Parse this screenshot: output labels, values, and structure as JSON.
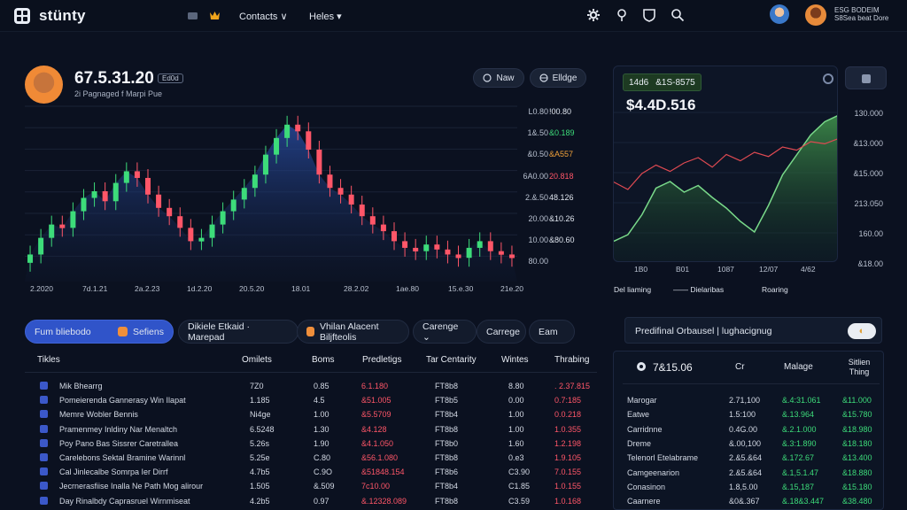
{
  "nav": {
    "brand": "stünty",
    "links": [
      "Contacts ∨",
      "Heles ▾"
    ]
  },
  "user": {
    "line1": "ESG BODEIM",
    "line2": "S8Sea beat Dore"
  },
  "header": {
    "price": "67.5.31.20",
    "chip": "Ed0d",
    "subtitle": "2i Pagnaged f Marpi Pue",
    "buttons": [
      "Naw",
      "Elldge"
    ]
  },
  "main_chart": {
    "y_labels": [
      "L0.80",
      "1&.50",
      "&0.50",
      "6A0.00",
      "2.&.50",
      "20.00",
      "10.00",
      "80.00"
    ],
    "badges": [
      "!00.80",
      "&0.189",
      "&A557",
      "20.818",
      "48.126",
      "&10.26",
      "&80.60"
    ],
    "x_labels": [
      "2.2020",
      "7d.1.21",
      "2a.2.23",
      "1d.2.20",
      "20.5.20",
      "18.01",
      "28.2.02",
      "1ae.80",
      "15.e.30",
      "21e.20"
    ]
  },
  "chart_data": {
    "type": "candlestick",
    "title": "",
    "y_tick_labels": [
      "L0.80",
      "1&.50",
      "&0.50",
      "6A0.00",
      "2.&.50",
      "20.00",
      "10.00",
      "80.00"
    ],
    "x_tick_labels": [
      "2.2020",
      "7d.1.21",
      "2a.2.23",
      "1d.2.20",
      "20.5.20",
      "18.01",
      "28.2.02",
      "1ae.80",
      "15.e.30",
      "21e.20"
    ],
    "close_levels": [
      0.12,
      0.22,
      0.3,
      0.28,
      0.38,
      0.46,
      0.5,
      0.44,
      0.55,
      0.62,
      0.58,
      0.48,
      0.4,
      0.35,
      0.28,
      0.2,
      0.22,
      0.3,
      0.38,
      0.45,
      0.52,
      0.6,
      0.72,
      0.82,
      0.9,
      0.86,
      0.75,
      0.6,
      0.52,
      0.48,
      0.42,
      0.35,
      0.3,
      0.26,
      0.2,
      0.16,
      0.14,
      0.18,
      0.15,
      0.12,
      0.1,
      0.16,
      0.2,
      0.14,
      0.12,
      0.1
    ]
  },
  "side_chart": {
    "badge": "14d6",
    "badge_value": "&1S-8575",
    "value": "$4.4D.516",
    "y_labels": [
      "130.000",
      "&13.000",
      "&15.000",
      "213.050",
      "160.00",
      "&18.00"
    ],
    "x_labels": [
      "1B0",
      "B01",
      "1087",
      "12/07",
      "4/62"
    ],
    "legend": [
      "Del liaming",
      "—— Dielaribas",
      "Roaring"
    ]
  },
  "tabs": [
    "Fum bliebodo",
    "Sefiens",
    "Dikiele Etkaid  · Marepad",
    "Vhilan Alacent Biljfteolis",
    "Carenge ⌄",
    "Carrege",
    "Eam"
  ],
  "table": {
    "headers": [
      "Tikles",
      "Omilets",
      "Boms",
      "Predletigs",
      "Tar Centarity",
      "Wintes",
      "Thrabing"
    ],
    "rows": [
      [
        "Mik Bhearrg",
        "7Z0",
        "0.85",
        "6.1.180",
        "FT8b8",
        "8.80",
        ". 2.37.815"
      ],
      [
        "Pomeierenda Gannerasy Win Ilapat",
        "1.185",
        "4.5",
        "&51.005",
        "FT8b5",
        "0.00",
        "0.7:185"
      ],
      [
        "Memre Wobler Bennis",
        "Ni4ge",
        "1.00",
        "&5.5709",
        "FT8b4",
        "1.00",
        "0.0.218"
      ],
      [
        "Pramenmey Inldiny Nar Menaltch",
        "6.5248",
        "1.30",
        "&4.128",
        "FT8b8",
        "1.00",
        "1.0.355"
      ],
      [
        "Poy Pano Bas Sissrer Caretrallea",
        "5.26s",
        "1.90",
        "&4.1.050",
        "FT8b0",
        "1.60",
        "1.2.198"
      ],
      [
        "Carelebons Sektal Bramine Warinnl",
        "5.25e",
        "C.80",
        "&56.1.080",
        "FT8b8",
        "0.e3",
        "1.9.105"
      ],
      [
        "Cal Jinlecalbe Somrpa Ier Dirrf",
        "4.7b5",
        "C.9O",
        "&51848.154",
        "FT8b6",
        "C3.90",
        "7.0.155"
      ],
      [
        "Jecrnerasfiise Inalla Ne Path Mog alirour",
        "1.505",
        "&.509",
        "7c10.00",
        "FT8b4",
        "C1.85",
        "1.0.155"
      ],
      [
        "Day Rinalbdy Caprasruel Wirnmiseat",
        "4.2b5",
        "0.97",
        "&.12328.089",
        "FT8b8",
        "C3.59",
        "1.0.168"
      ]
    ]
  },
  "side_panel": {
    "top_label": "Predifinal Orbausel | lughacignug",
    "top_toggle": "◐",
    "title": "7&15.06",
    "headers": [
      "Cr",
      "Malage",
      "Sitlien Thing"
    ],
    "rows": [
      [
        "Marogar",
        "2.71,100",
        "&.4:31.061",
        "&11.000"
      ],
      [
        "Eatwe",
        "1.5:100",
        "&.13.964",
        "&15.780"
      ],
      [
        "Carridnne",
        "0.4G.00",
        "&.2.1.000",
        "&18.980"
      ],
      [
        "Dreme",
        "&.00,100",
        "&.3:1.890",
        "&18.180"
      ],
      [
        "Telenorl Etelabrame",
        "2.&5.&64",
        "&.172.67",
        "&13.400"
      ],
      [
        "Camgeenarion",
        "2.&5.&64",
        "&.1,5.1.47",
        "&18.880"
      ],
      [
        "Conasinon",
        "1.8,5.00",
        "&.15,187",
        "&15.180"
      ],
      [
        "Caarnere",
        "&0&.367",
        "&.18&3.447",
        "&38.480"
      ]
    ]
  },
  "colors": {
    "up": "#3ddc7a",
    "down": "#ff5668",
    "accent": "#3054c9"
  }
}
